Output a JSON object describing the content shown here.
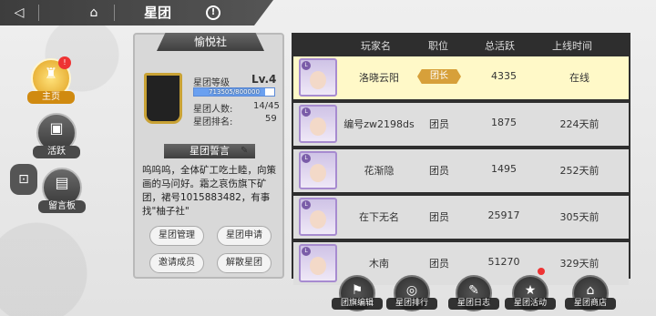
{
  "header": {
    "title": "星团",
    "back_icon": "◁",
    "home_icon": "⌂",
    "info_icon": "!"
  },
  "nav": [
    {
      "label": "主页",
      "icon": "♜",
      "badge": "!",
      "active": true
    },
    {
      "label": "活跃",
      "icon": "▣",
      "active": false
    },
    {
      "label": "留言板",
      "icon": "▤",
      "active": false
    }
  ],
  "side_button": {
    "icon": "⊡"
  },
  "guild": {
    "name": "愉悦社",
    "level_label": "星团等级",
    "level": "Lv.4",
    "exp_text": "713505/800000",
    "exp_fraction": 0.89,
    "members_label": "星团人数:",
    "members": "14/45",
    "rank_label": "星团排名:",
    "rank": "59",
    "declaration_title": "星团誓言",
    "declaration": "呜呜呜，全体矿工吃土睦，向策画的马问好。霜之哀伤旗下矿团，裙号1015883482，有事找\"柚子社\"",
    "buttons": [
      "星团管理",
      "星团申请",
      "邀请成员",
      "解散星团"
    ]
  },
  "table": {
    "headers": [
      "玩家名",
      "职位",
      "总活跃",
      "上线时间"
    ],
    "rows": [
      {
        "name": "洛晓云阳",
        "role": "团长",
        "activity": "4335",
        "online": "在线",
        "leader": true
      },
      {
        "name": "编号zw2198ds",
        "role": "团员",
        "activity": "1875",
        "online": "224天前"
      },
      {
        "name": "花渐隐",
        "role": "团员",
        "activity": "1495",
        "online": "252天前"
      },
      {
        "name": "在下无名",
        "role": "团员",
        "activity": "25917",
        "online": "305天前"
      },
      {
        "name": "木南",
        "role": "团员",
        "activity": "51270",
        "online": "329天前"
      }
    ]
  },
  "bottom": [
    {
      "label": "团旗编辑",
      "icon": "⚑"
    },
    {
      "label": "星团排行",
      "icon": "◎"
    },
    {
      "label": "星团日志",
      "icon": "✎"
    },
    {
      "label": "星团活动",
      "icon": "★"
    },
    {
      "label": "星团商店",
      "icon": "⌂"
    }
  ],
  "colors": {
    "accent": "#e0a020",
    "leader_role": "#d7a03a",
    "highlight_row": "#fff9c8"
  }
}
